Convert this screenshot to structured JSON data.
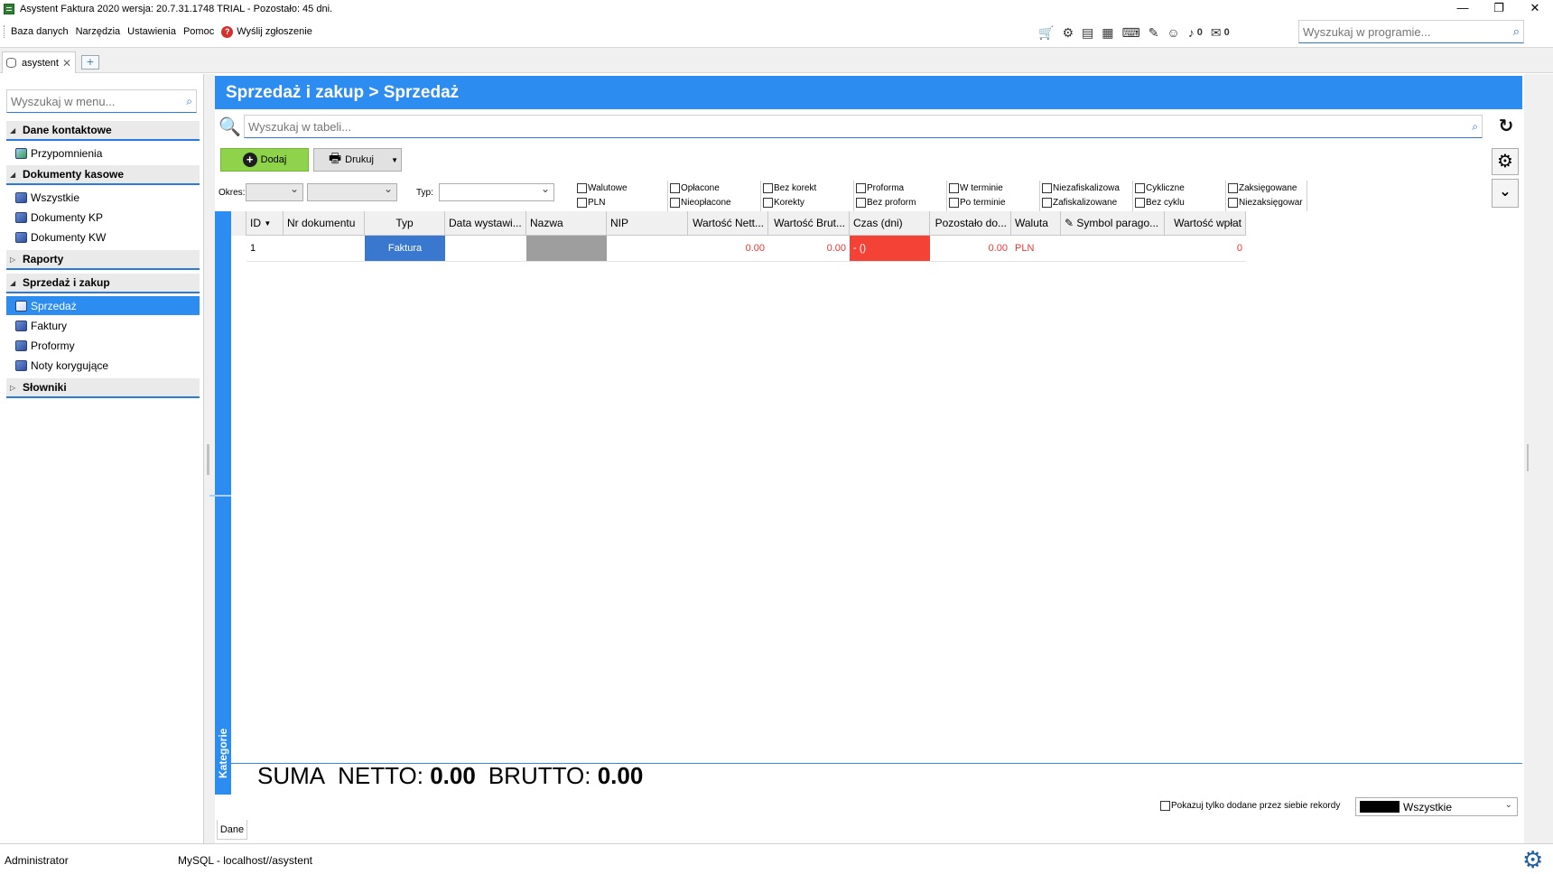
{
  "window": {
    "title": "Asystent Faktura 2020 wersja: 20.7.31.1748 TRIAL - Pozostało: 45 dni.",
    "minimize": "—",
    "restore": "❐",
    "close": "✕"
  },
  "menu": {
    "items": [
      "Baza danych",
      "Narzędzia",
      "Ustawienia",
      "Pomoc"
    ],
    "report": "Wyślij zgłoszenie"
  },
  "topicons": {
    "notifications_count": "0",
    "messages_count": "0"
  },
  "global_search": {
    "placeholder": "Wyszukaj w programie..."
  },
  "tabs": {
    "active": "asystent",
    "close": "✕",
    "add": "+"
  },
  "sidebar": {
    "search_placeholder": "Wyszukaj w menu...",
    "groups": [
      {
        "label": "Dane kontaktowe",
        "items": [
          "Przypomnienia"
        ]
      },
      {
        "label": "Dokumenty kasowe",
        "items": [
          "Wszystkie",
          "Dokumenty KP",
          "Dokumenty KW"
        ]
      },
      {
        "label": "Raporty",
        "items": []
      },
      {
        "label": "Sprzedaż i zakup",
        "items": [
          "Sprzedaż",
          "Faktury",
          "Proformy",
          "Noty korygujące"
        ]
      },
      {
        "label": "Słowniki",
        "items": []
      }
    ],
    "selected": "Sprzedaż"
  },
  "main": {
    "header": "Sprzedaż i zakup > Sprzedaż",
    "table_search_placeholder": "Wyszukaj w tabeli...",
    "add_label": "Dodaj",
    "print_label": "Drukuj",
    "filters": {
      "okres_label": "Okres:",
      "typ_label": "Typ:",
      "checkboxes": [
        [
          "Walutowe",
          "PLN"
        ],
        [
          "Opłacone",
          "Nieopłacone"
        ],
        [
          "Bez korekt",
          "Korekty"
        ],
        [
          "Proforma",
          "Bez proform"
        ],
        [
          "W terminie",
          "Po terminie"
        ],
        [
          "Niezafiskalizowa",
          "Zafiskalizowane"
        ],
        [
          "Cykliczne",
          "Bez cyklu"
        ],
        [
          "Zaksięgowane",
          "Niezaksięgowar"
        ]
      ]
    },
    "kategorie_label": "Kategorie",
    "columns": [
      "ID",
      "Nr dokumentu",
      "Typ",
      "Data wystawi...",
      "Nazwa",
      "NIP",
      "Wartość Nett...",
      "Wartość Brut...",
      "Czas (dni)",
      "Pozostało do...",
      "Waluta",
      "Symbol parago...",
      "Wartość wpłat"
    ],
    "rows": [
      {
        "id": "1",
        "nr": "",
        "typ": "Faktura",
        "data": "",
        "nazwa": "",
        "nip": "",
        "netto": "0.00",
        "brutto": "0.00",
        "czas": "- ()",
        "pozostalo": "0.00",
        "waluta": "PLN",
        "symbol": "",
        "wplaty": "0"
      }
    ],
    "summary": {
      "suma": "SUMA",
      "netto_label": "NETTO:",
      "netto_value": "0.00",
      "brutto_label": "BRUTTO:",
      "brutto_value": "0.00"
    },
    "show_own_label": "Pokazuj tylko dodane przez siebie rekordy",
    "user_filter": "Wszystkie",
    "bottom_tab": "Dane"
  },
  "status": {
    "user": "Administrator",
    "connection": "MySQL - localhost//asystent"
  },
  "colors": {
    "accent": "#2d8cf0",
    "add_green": "#8fd34a",
    "typ_cell": "#3a78d0",
    "overdue_red": "#f44336"
  }
}
